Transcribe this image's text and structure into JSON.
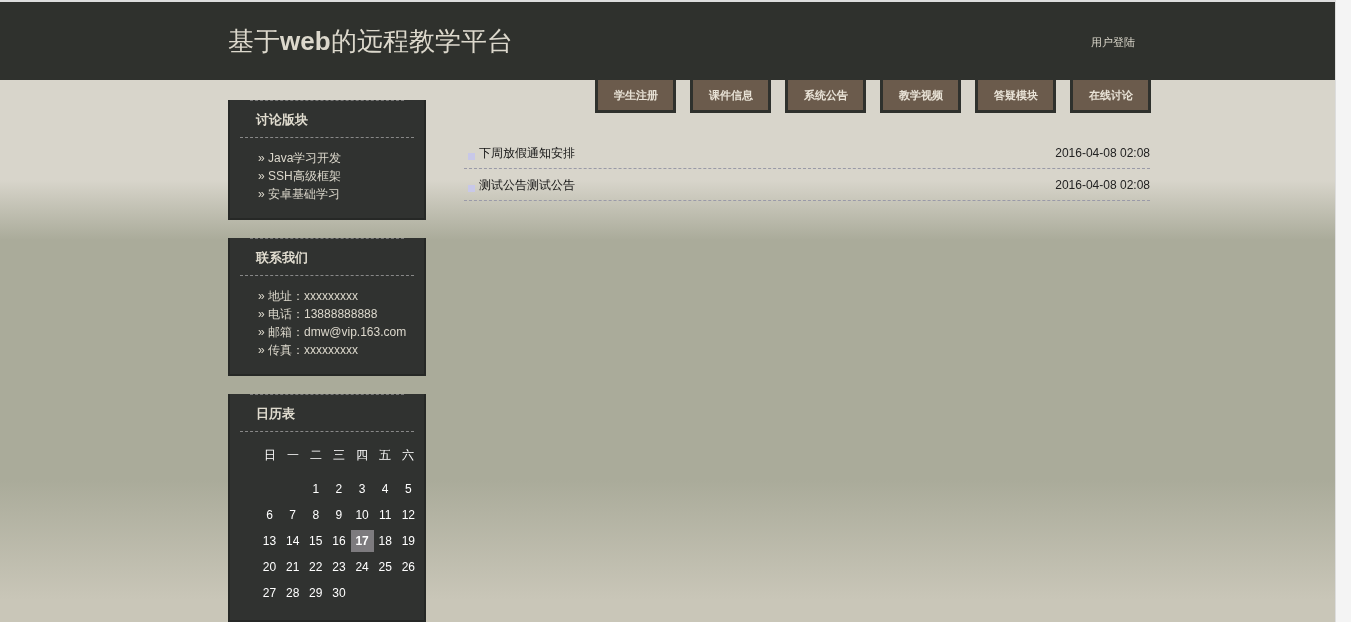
{
  "header": {
    "title": "基于**web**的远程教学平台",
    "login_link": "用户登陆"
  },
  "nav": [
    {
      "label": "学生注册"
    },
    {
      "label": "课件信息"
    },
    {
      "label": "系统公告"
    },
    {
      "label": "教学视频"
    },
    {
      "label": "答疑模块"
    },
    {
      "label": "在线讨论"
    }
  ],
  "sidebar": [
    {
      "title": "讨论版块",
      "items": [
        "» Java学习开发",
        "» SSH高级框架",
        "» 安卓基础学习"
      ]
    },
    {
      "title": "联系我们",
      "items": [
        "» 地址：xxxxxxxxx",
        "» 电话：13888888888",
        "» 邮箱：dmw@vip.163.com",
        "» 传真：xxxxxxxxx"
      ]
    }
  ],
  "calendar": {
    "title": "日历表",
    "weekdays": [
      "日",
      "一",
      "二",
      "三",
      "四",
      "五",
      "六"
    ],
    "weeks": [
      [
        {
          "kind": "blank"
        },
        {
          "kind": "blank"
        },
        {
          "kind": "day",
          "day": "1",
          "selected": false
        },
        {
          "kind": "day",
          "day": "2",
          "selected": false
        },
        {
          "kind": "day",
          "day": "3",
          "selected": false
        },
        {
          "kind": "day",
          "day": "4",
          "selected": false
        },
        {
          "kind": "day",
          "day": "5",
          "selected": false
        }
      ],
      [
        {
          "kind": "day",
          "day": "6",
          "selected": false
        },
        {
          "kind": "day",
          "day": "7",
          "selected": false
        },
        {
          "kind": "day",
          "day": "8",
          "selected": false
        },
        {
          "kind": "day",
          "day": "9",
          "selected": false
        },
        {
          "kind": "day",
          "day": "10",
          "selected": false
        },
        {
          "kind": "day",
          "day": "11",
          "selected": false
        },
        {
          "kind": "day",
          "day": "12",
          "selected": false
        }
      ],
      [
        {
          "kind": "day",
          "day": "13",
          "selected": false
        },
        {
          "kind": "day",
          "day": "14",
          "selected": false
        },
        {
          "kind": "day",
          "day": "15",
          "selected": false
        },
        {
          "kind": "day",
          "day": "16",
          "selected": false
        },
        {
          "kind": "day",
          "day": "17",
          "selected": true
        },
        {
          "kind": "day",
          "day": "18",
          "selected": false
        },
        {
          "kind": "day",
          "day": "19",
          "selected": false
        }
      ],
      [
        {
          "kind": "day",
          "day": "20",
          "selected": false
        },
        {
          "kind": "day",
          "day": "21",
          "selected": false
        },
        {
          "kind": "day",
          "day": "22",
          "selected": false
        },
        {
          "kind": "day",
          "day": "23",
          "selected": false
        },
        {
          "kind": "day",
          "day": "24",
          "selected": false
        },
        {
          "kind": "day",
          "day": "25",
          "selected": false
        },
        {
          "kind": "day",
          "day": "26",
          "selected": false
        }
      ],
      [
        {
          "kind": "day",
          "day": "27",
          "selected": false
        },
        {
          "kind": "day",
          "day": "28",
          "selected": false
        },
        {
          "kind": "day",
          "day": "29",
          "selected": false
        },
        {
          "kind": "day",
          "day": "30",
          "selected": false
        }
      ]
    ]
  },
  "notices": [
    {
      "title": "下周放假通知安排",
      "date": "2016-04-08 02:08"
    },
    {
      "title": "测试公告测试公告",
      "date": "2016-04-08 02:08"
    }
  ]
}
